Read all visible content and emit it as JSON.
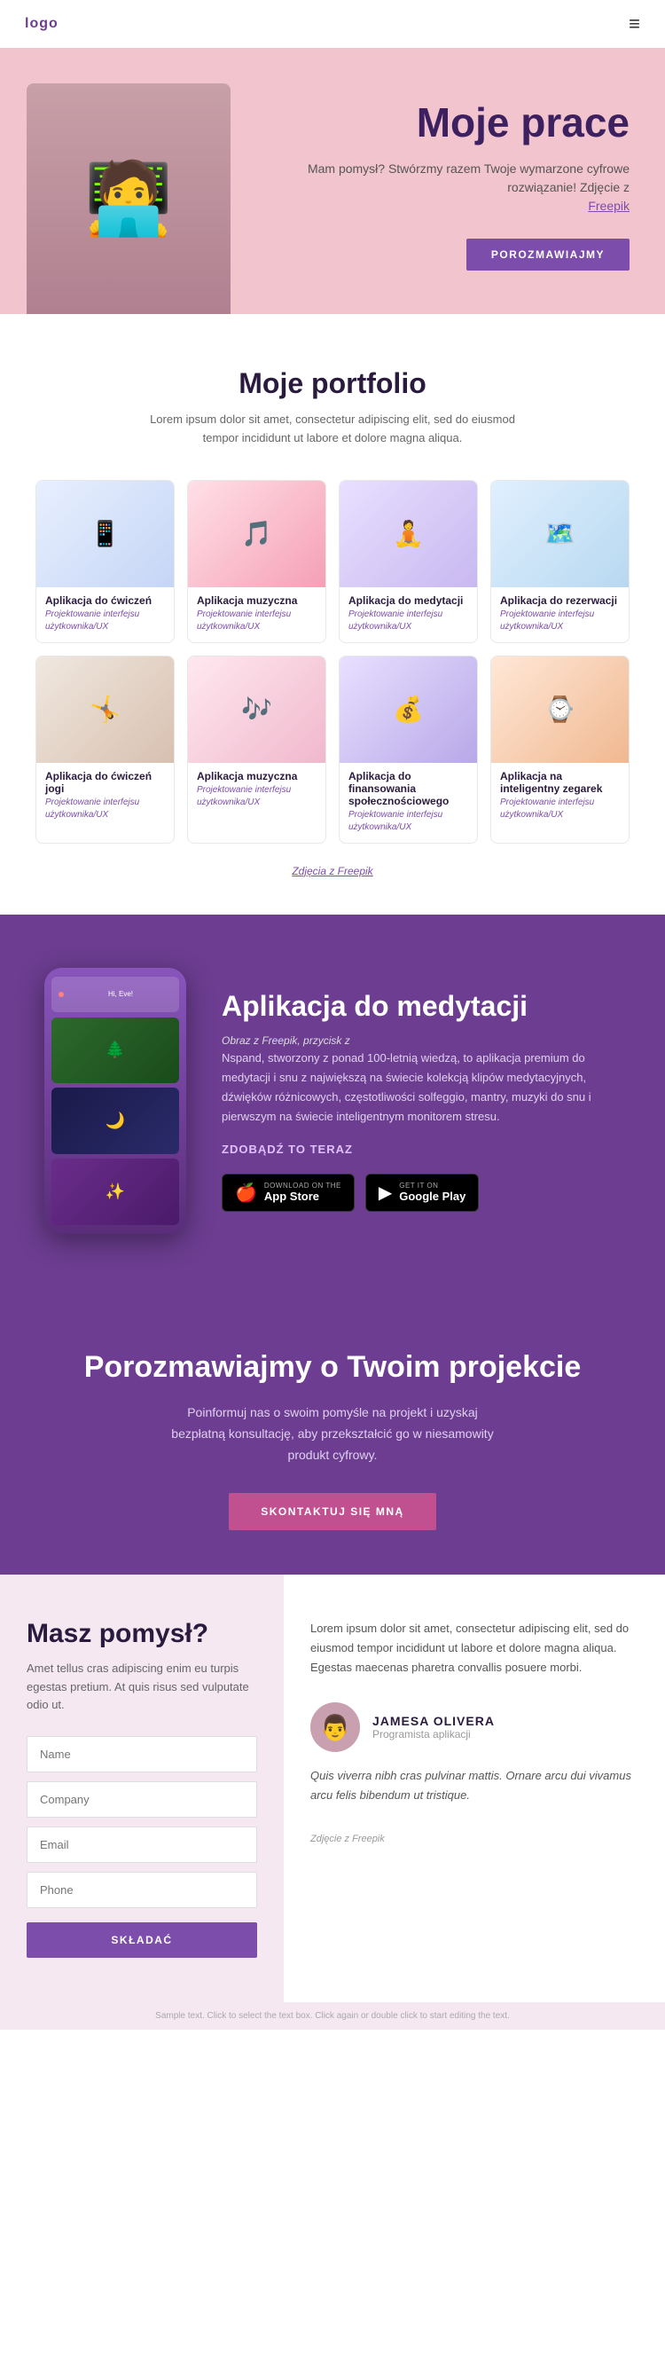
{
  "header": {
    "logo": "logo",
    "menu_icon": "≡"
  },
  "hero": {
    "title": "Moje prace",
    "description": "Mam pomysł? Stwórzmy razem Twoje wymarzone cyfrowe rozwiązanie! Zdjęcie z",
    "link_text": "Freepik",
    "button_label": "POROZMAWIAJMY",
    "person_emoji": "👨‍💼"
  },
  "portfolio": {
    "title": "Moje portfolio",
    "subtitle": "Lorem ipsum dolor sit amet, consectetur adipiscing elit, sed do eiusmod tempor incididunt ut labore et dolore magna aliqua.",
    "footer_text": "Zdjęcia z Freepik",
    "items": [
      {
        "name": "Aplikacja do ćwiczeń",
        "category": "Projektowanie interfejsu użytkownika/UX",
        "emoji": "📱",
        "thumb_class": "thumb-1"
      },
      {
        "name": "Aplikacja muzyczna",
        "category": "Projektowanie interfejsu użytkownika/UX",
        "emoji": "🎵",
        "thumb_class": "thumb-2"
      },
      {
        "name": "Aplikacja do medytacji",
        "category": "Projektowanie interfejsu użytkownika/UX",
        "emoji": "🧘",
        "thumb_class": "thumb-3"
      },
      {
        "name": "Aplikacja do rezerwacji",
        "category": "Projektowanie interfejsu użytkownika/UX",
        "emoji": "🗺️",
        "thumb_class": "thumb-4"
      },
      {
        "name": "Aplikacja do ćwiczeń jogi",
        "category": "Projektowanie interfejsu użytkownika/UX",
        "emoji": "🤸",
        "thumb_class": "thumb-5"
      },
      {
        "name": "Aplikacja muzyczna",
        "category": "Projektowanie interfejsu użytkownika/UX",
        "emoji": "🎶",
        "thumb_class": "thumb-6"
      },
      {
        "name": "Aplikacja do finansowania społecznościowego",
        "category": "Projektowanie interfejsu użytkownika/UX",
        "emoji": "💰",
        "thumb_class": "thumb-7"
      },
      {
        "name": "Aplikacja na inteligentny zegarek",
        "category": "Projektowanie interfejsu użytkownika/UX",
        "emoji": "⌚",
        "thumb_class": "thumb-8"
      }
    ]
  },
  "meditation": {
    "title": "Aplikacja do medytacji",
    "subtitle": "Obraz z Freepik, przycisk z",
    "description": "Nspand, stworzony z ponad 100-letnią wiedzą, to aplikacja premium do medytacji i snu z największą na świecie kolekcją klipów medytacyjnych, dźwięków różnicowych, częstotliwości solfeggio, mantry, muzyki do snu i pierwszym na świecie inteligentnym monitorem stresu.",
    "cta": "ZDOBĄDŹ TO TERAZ",
    "app_store_label": "Download on the",
    "app_store_name": "App Store",
    "google_play_label": "GET IT ON",
    "google_play_name": "Google Play"
  },
  "contact": {
    "title": "Porozmawiajmy o Twoim projekcie",
    "description": "Poinformuj nas o swoim pomyśle na projekt i uzyskaj bezpłatną konsultację, aby przekształcić go w niesamowity produkt cyfrowy.",
    "button_label": "SKONTAKTUJ SIĘ MNĄ"
  },
  "form": {
    "title": "Masz pomysł?",
    "description": "Amet tellus cras adipiscing enim eu turpis egestas pretium. At quis risus sed vulputate odio ut.",
    "fields": [
      {
        "placeholder": "Name",
        "type": "text"
      },
      {
        "placeholder": "Company",
        "type": "text"
      },
      {
        "placeholder": "Email",
        "type": "email"
      },
      {
        "placeholder": "Phone",
        "type": "tel"
      }
    ],
    "submit_label": "SKŁADAĆ"
  },
  "testimonial": {
    "body_text": "Lorem ipsum dolor sit amet, consectetur adipiscing elit, sed do eiusmod tempor incididunt ut labore et dolore magna aliqua. Egestas maecenas pharetra convallis posuere morbi.",
    "name": "JAMESA OLIVERA",
    "role": "Programista aplikacji",
    "quote": "Quis viverra nibh cras pulvinar mattis. Ornare arcu dui vivamus arcu felis bibendum ut tristique.",
    "photo_credit": "Zdjęcie z Freepik",
    "avatar_emoji": "👨"
  },
  "footer": {
    "text": "Sample text. Click to select the text box. Click again or double click to start editing the text."
  }
}
